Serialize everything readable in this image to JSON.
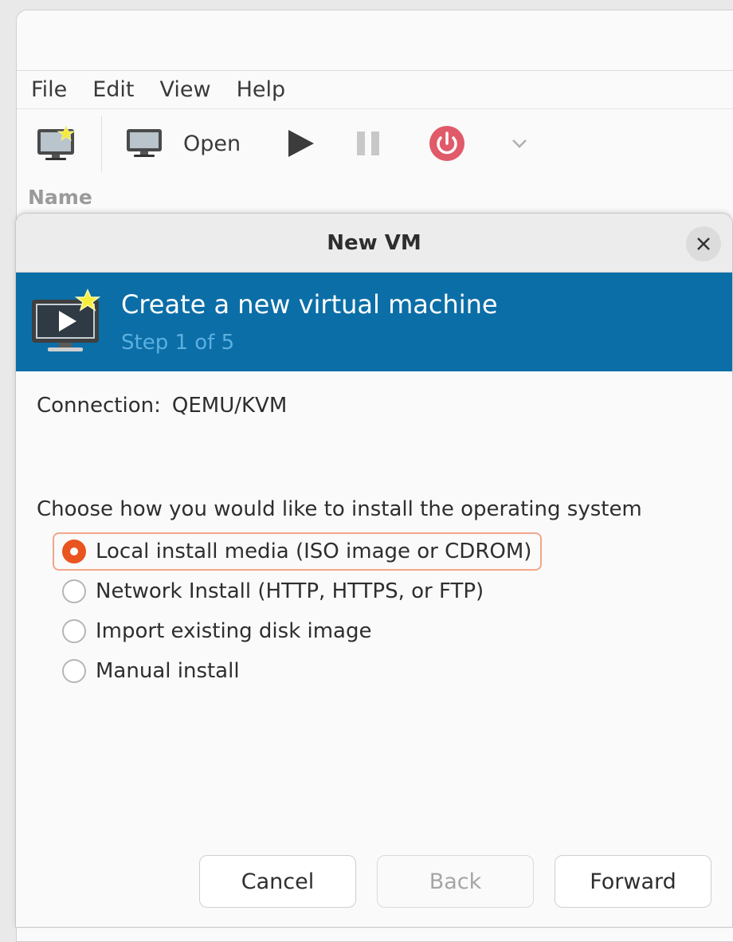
{
  "main_window": {
    "menu": [
      "File",
      "Edit",
      "View",
      "Help"
    ],
    "toolbar": {
      "new_vm_icon": "monitor-star-icon",
      "open_icon": "monitor-icon",
      "open_label": "Open",
      "run_icon": "play-icon",
      "pause_icon": "pause-icon",
      "shutdown_icon": "power-icon",
      "dropdown_icon": "chevron-down-icon"
    },
    "list_header": "Name"
  },
  "dialog": {
    "title": "New VM",
    "close_icon": "close-icon",
    "banner": {
      "title": "Create a new virtual machine",
      "step": "Step 1 of 5",
      "icon": "monitor-play-star-icon"
    },
    "connection_label": "Connection:",
    "connection_value": "QEMU/KVM",
    "install_prompt": "Choose how you would like to install the operating system",
    "options": [
      {
        "label": "Local install media (ISO image or CDROM)",
        "selected": true
      },
      {
        "label": "Network Install (HTTP, HTTPS, or FTP)",
        "selected": false
      },
      {
        "label": "Import existing disk image",
        "selected": false
      },
      {
        "label": "Manual install",
        "selected": false
      }
    ],
    "buttons": {
      "cancel": "Cancel",
      "back": "Back",
      "forward": "Forward"
    }
  },
  "colors": {
    "banner": "#0c6ea7",
    "banner_subtitle": "#5bb0e0",
    "accent": "#e9541f",
    "power": "#e05a6a"
  }
}
